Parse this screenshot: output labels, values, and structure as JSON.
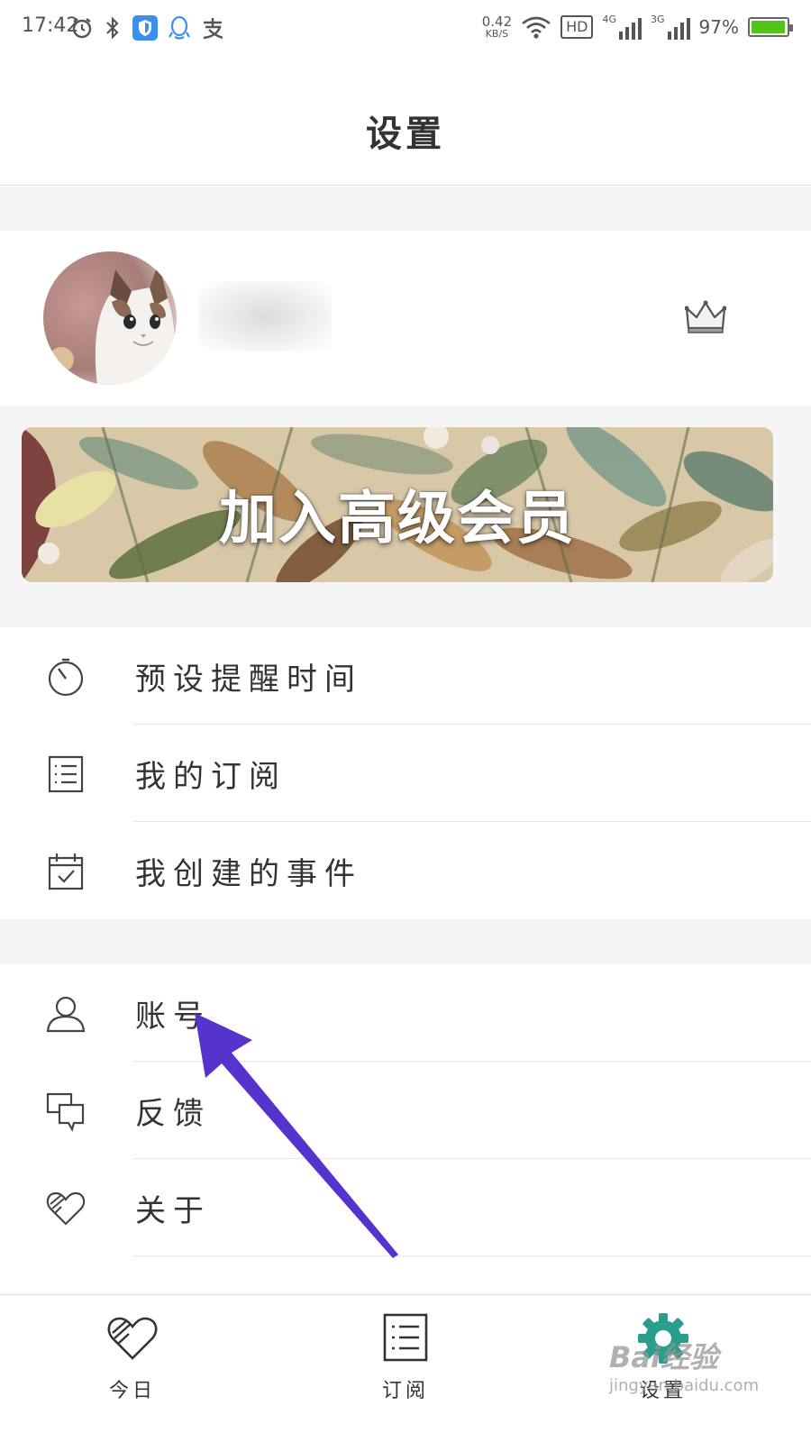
{
  "status_bar": {
    "time": "17:42",
    "net_speed_value": "0.42",
    "net_speed_unit": "KB/S",
    "hd_label": "HD",
    "network_1": "4G",
    "network_2": "3G",
    "battery_percent": "97%",
    "battery_level": 0.97,
    "battery_color": "#52c41a"
  },
  "header": {
    "title": "设置"
  },
  "profile": {
    "has_vip_crown": true
  },
  "banner": {
    "text": "加入高级会员"
  },
  "menu_group_1": [
    {
      "label": "预设提醒时间",
      "icon": "timer-icon"
    },
    {
      "label": "我的订阅",
      "icon": "list-icon"
    },
    {
      "label": "我创建的事件",
      "icon": "calendar-check-icon"
    }
  ],
  "menu_group_2": [
    {
      "label": "账号",
      "icon": "user-icon"
    },
    {
      "label": "反馈",
      "icon": "chat-bubbles-icon"
    },
    {
      "label": "关于",
      "icon": "heart-icon"
    }
  ],
  "tabs": [
    {
      "label": "今日",
      "icon": "heart-icon",
      "active": false
    },
    {
      "label": "订阅",
      "icon": "list-icon",
      "active": false
    },
    {
      "label": "设置",
      "icon": "gear-icon",
      "active": true
    }
  ],
  "accent_color": "#2a9d8f",
  "annotation_arrow_color": "#5533cc",
  "watermark": {
    "line1": "Bai经验",
    "line2": "jingyan.baidu.com"
  }
}
